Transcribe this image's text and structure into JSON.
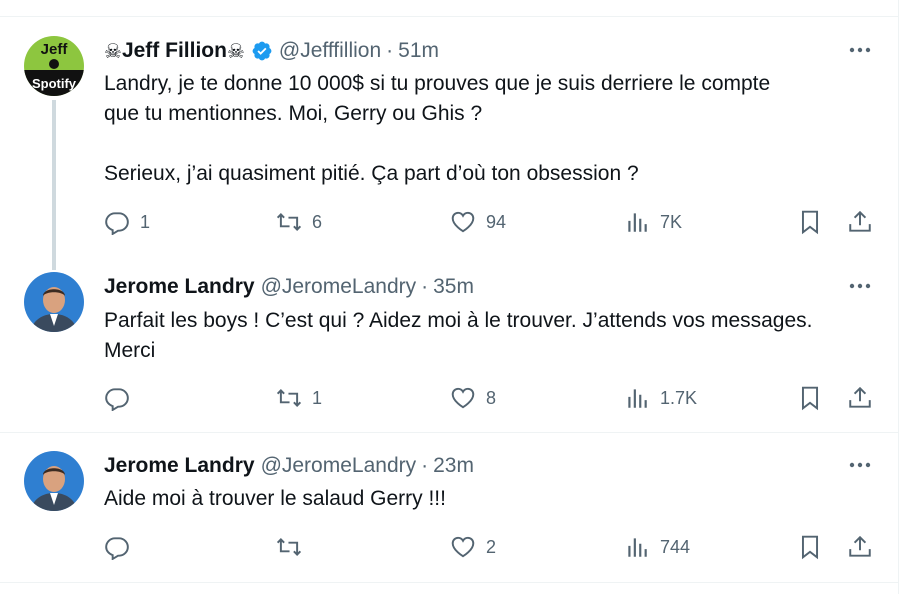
{
  "tweets": [
    {
      "name": "Jeff Fillion",
      "name_prefix": "☠",
      "name_suffix": "☠",
      "verified": true,
      "handle": "@Jefffillion",
      "separator": "·",
      "time": "51m",
      "text": "Landry, je te donne 10 000$ si tu prouves que je suis derriere le compte\nque tu mentionnes. Moi, Gerry ou Ghis ?\n\nSerieux, j’ai quasiment pitié. Ça part d’où ton obsession ?",
      "avatar_label_top": "Jeff",
      "avatar_label_bottom": "Spotify",
      "avatar_color": "#8dc63f",
      "replies": "1",
      "retweets": "6",
      "likes": "94",
      "views": "7K"
    },
    {
      "name": "Jerome Landry",
      "handle": "@JeromeLandry",
      "separator": "·",
      "time": "35m",
      "text": "Parfait les boys ! C’est qui ? Aidez moi à le trouver. J’attends vos messages.\nMerci",
      "replies": "",
      "retweets": "1",
      "likes": "8",
      "views": "1.7K"
    },
    {
      "name": "Jerome Landry",
      "handle": "@JeromeLandry",
      "separator": "·",
      "time": "23m",
      "text": "Aide moi à trouver le salaud Gerry !!!",
      "replies": "",
      "retweets": "",
      "likes": "2",
      "views": "744"
    }
  ],
  "colors": {
    "text": "#0f1419",
    "secondary": "#536471",
    "border": "#eff3f4",
    "verified": "#1d9bf0",
    "thread_line": "#cfd9de"
  }
}
